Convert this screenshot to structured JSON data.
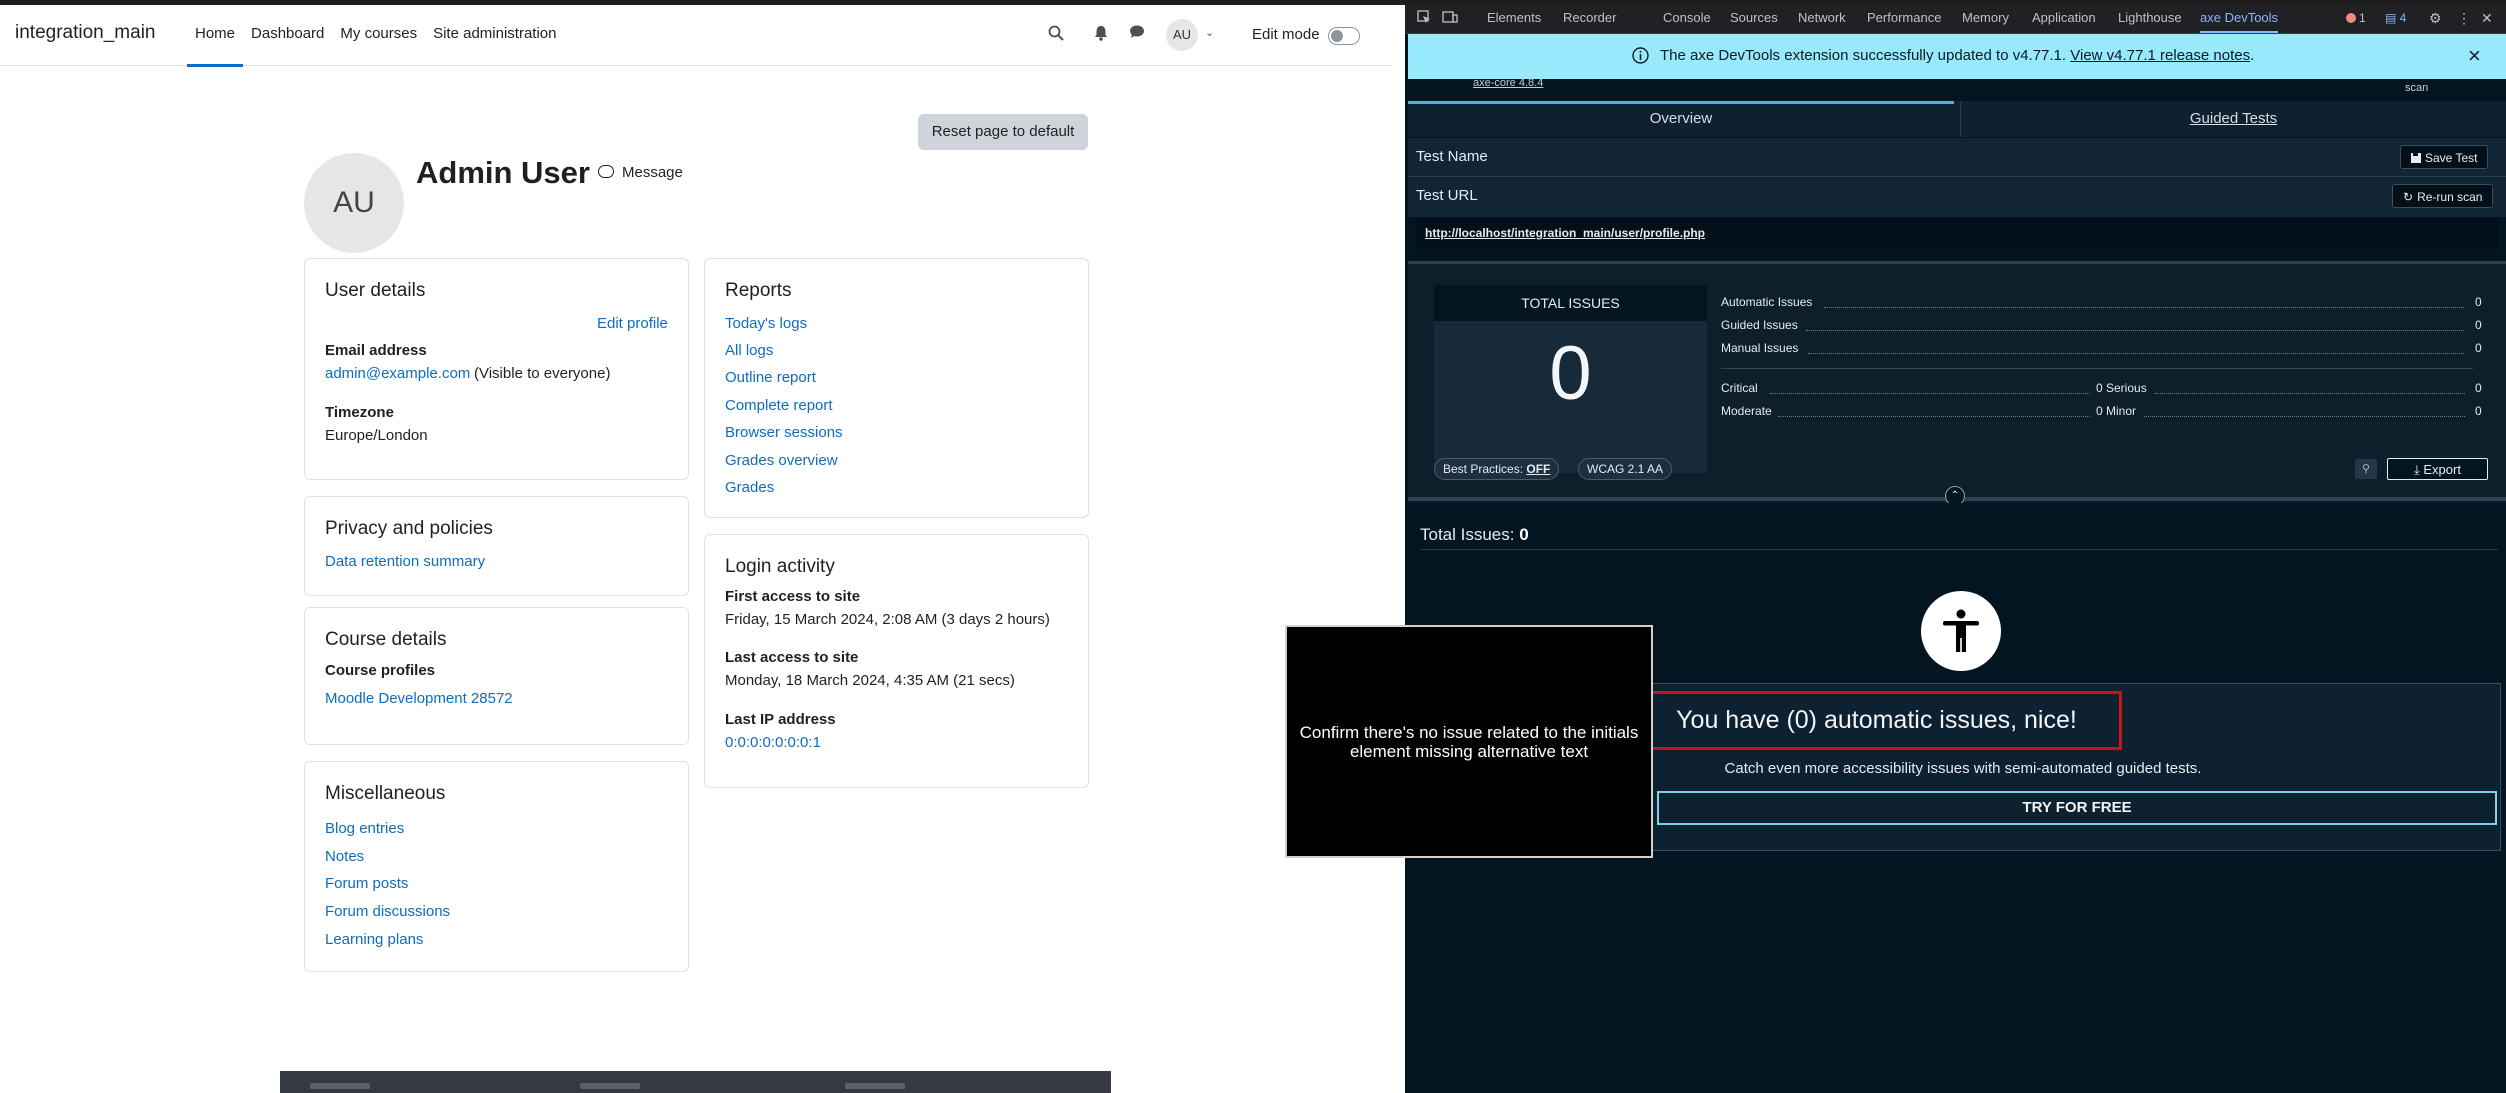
{
  "moodle": {
    "brand": "integration_main",
    "nav": [
      {
        "label": "Home",
        "active": true
      },
      {
        "label": "Dashboard"
      },
      {
        "label": "My courses"
      },
      {
        "label": "Site administration"
      }
    ],
    "avatar_initials": "AU",
    "edit_mode_label": "Edit mode",
    "reset_button": "Reset page to default",
    "profile": {
      "initials": "AU",
      "name": "Admin User",
      "message_label": "Message"
    },
    "user_details": {
      "title": "User details",
      "edit_profile": "Edit profile",
      "email_label": "Email address",
      "email": "admin@example.com",
      "email_visibility": "(Visible to everyone)",
      "timezone_label": "Timezone",
      "timezone": "Europe/London"
    },
    "privacy": {
      "title": "Privacy and policies",
      "links": [
        "Data retention summary"
      ]
    },
    "course_details": {
      "title": "Course details",
      "subtitle": "Course profiles",
      "links": [
        "Moodle Development 28572"
      ]
    },
    "misc": {
      "title": "Miscellaneous",
      "links": [
        "Blog entries",
        "Notes",
        "Forum posts",
        "Forum discussions",
        "Learning plans"
      ]
    },
    "reports": {
      "title": "Reports",
      "links": [
        "Today's logs",
        "All logs",
        "Outline report",
        "Complete report",
        "Browser sessions",
        "Grades overview",
        "Grades"
      ]
    },
    "login_activity": {
      "title": "Login activity",
      "first_label": "First access to site",
      "first_value": "Friday, 15 March 2024, 2:08 AM  (3 days 2 hours)",
      "last_label": "Last access to site",
      "last_value": "Monday, 18 March 2024, 4:35 AM  (21 secs)",
      "ip_label": "Last IP address",
      "ip_value": "0:0:0:0:0:0:0:1"
    }
  },
  "overlay": {
    "text": "Confirm there's no issue related to the initials element missing alternative text"
  },
  "devtools": {
    "tabs": [
      "Elements",
      "Recorder",
      "Console",
      "Sources",
      "Network",
      "Performance",
      "Memory",
      "Application",
      "Lighthouse",
      "axe DevTools"
    ],
    "active_tab": "axe DevTools",
    "error_count": "1",
    "issue_count": "4",
    "banner": {
      "text": "The axe DevTools extension successfully updated to v4.77.1.",
      "link": "View v4.77.1 release notes",
      "suffix": "."
    },
    "axe_version": "axe-core 4.8.4",
    "scan_label": "scan",
    "panel_tabs": {
      "overview": "Overview",
      "guided": "Guided Tests"
    },
    "test_name_label": "Test Name",
    "save_test": "Save Test",
    "test_url_label": "Test URL",
    "rerun_scan": "Re-run scan",
    "url": "http://localhost/integration_main/user/profile.php",
    "total_issues_label": "TOTAL ISSUES",
    "total_issues": "0",
    "counts": {
      "automatic_label": "Automatic Issues",
      "automatic": "0",
      "guided_label": "Guided Issues",
      "guided": "0",
      "manual_label": "Manual Issues",
      "manual": "0",
      "critical_label": "Critical",
      "critical": "0",
      "serious_label": "Serious",
      "serious": "0",
      "moderate_label": "Moderate",
      "moderate": "0",
      "minor_label": "Minor",
      "minor": "0"
    },
    "best_practices_label": "Best Practices:",
    "best_practices_value": "OFF",
    "standard": "WCAG 2.1 AA",
    "export": "Export",
    "results_label": "Total Issues:",
    "results_count": "0",
    "nice_text": "You have (0) automatic issues, nice!",
    "catch_text": "Catch even more accessibility issues with semi-automated guided tests.",
    "try_free": "TRY FOR FREE"
  }
}
